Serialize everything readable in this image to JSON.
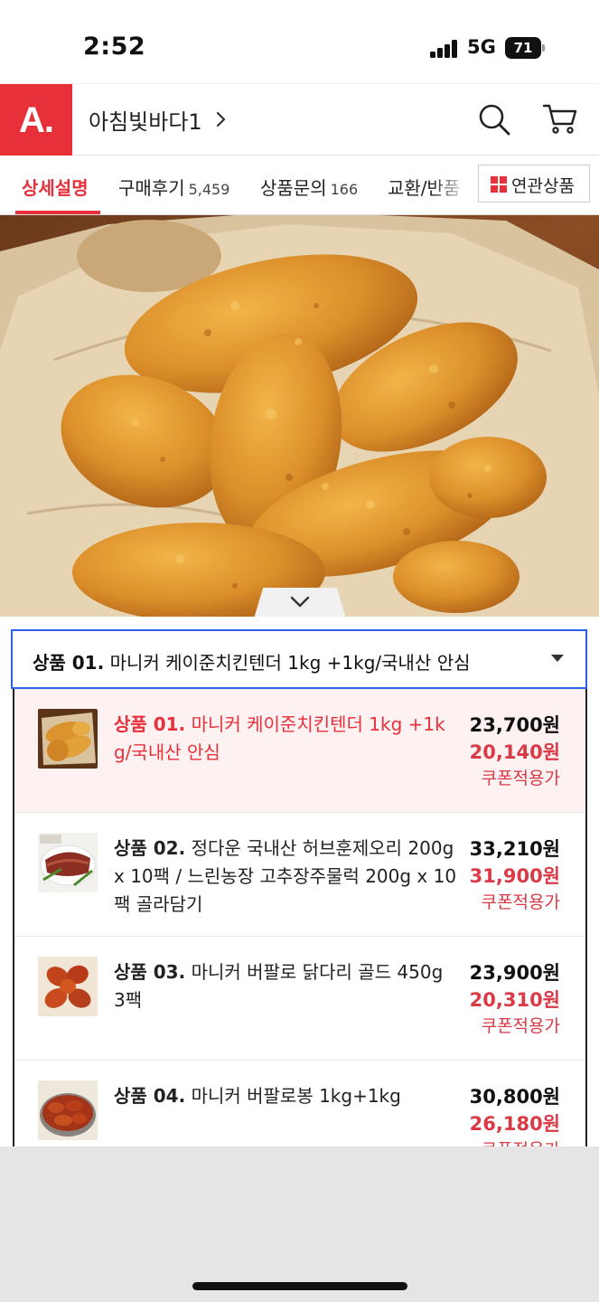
{
  "status_bar": {
    "time": "2:52",
    "network": "5G",
    "battery": "71"
  },
  "header": {
    "logo": "A.",
    "store_name": "아침빛바다1",
    "icons": [
      "search-icon",
      "cart-icon",
      "chevron-right-icon"
    ]
  },
  "tabs": {
    "items": [
      {
        "label": "상세설명",
        "count": ""
      },
      {
        "label": "구매후기",
        "count": "5,459"
      },
      {
        "label": "상품문의",
        "count": "166"
      },
      {
        "label": "교환/반품",
        "count": ""
      }
    ],
    "related_label": "연관상품"
  },
  "accent_color": "#e8303b",
  "dropdown": {
    "prefix": "상품 01.",
    "text": "마니커 케이준치킨텐더 1kg +1kg/국내산 안심"
  },
  "options": [
    {
      "prefix": "상품 01.",
      "name": "마니커 케이준치킨텐더 1kg +1kg/국내산 안심",
      "price": "23,700원",
      "sale_price": "20,140원",
      "note": "쿠폰적용가",
      "selected": true
    },
    {
      "prefix": "상품 02.",
      "name": "정다운 국내산 허브훈제오리 200g x 10팩 / 느린농장 고추장주물럭 200g x 10팩 골라담기",
      "price": "33,210원",
      "sale_price": "31,900원",
      "note": "쿠폰적용가",
      "selected": false
    },
    {
      "prefix": "상품 03.",
      "name": "마니커 버팔로 닭다리 골드 450g 3팩",
      "price": "23,900원",
      "sale_price": "20,310원",
      "note": "쿠폰적용가",
      "selected": false
    },
    {
      "prefix": "상품 04.",
      "name": "마니커 버팔로봉 1kg+1kg",
      "price": "30,800원",
      "sale_price": "26,180원",
      "note": "쿠폰적용가",
      "selected": false
    }
  ]
}
